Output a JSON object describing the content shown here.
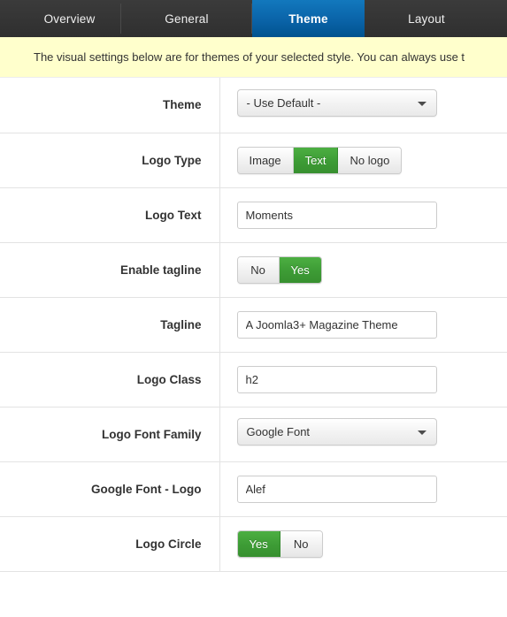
{
  "tabs": [
    {
      "label": "Overview",
      "active": false,
      "name": "tab-overview"
    },
    {
      "label": "General",
      "active": false,
      "name": "tab-general"
    },
    {
      "label": "Theme",
      "active": true,
      "name": "tab-theme"
    },
    {
      "label": "Layout",
      "active": false,
      "name": "tab-layout"
    }
  ],
  "notice": {
    "text": "The visual settings below are for themes of your selected style. You can always use t"
  },
  "colors": {
    "active_tab": "#0a63a8",
    "tabbar_bg": "#333333",
    "notice_bg": "#ffffcc",
    "toggle_on": "#3d9b35",
    "border": "#cccccc",
    "row_border": "#e3e3e3"
  },
  "rows": [
    {
      "label": "Theme",
      "type": "select",
      "value": "- Use Default -",
      "name": "theme"
    },
    {
      "label": "Logo Type",
      "type": "buttons",
      "options": [
        "Image",
        "Text",
        "No logo"
      ],
      "selected": "Text",
      "name": "logo-type"
    },
    {
      "label": "Logo Text",
      "type": "text",
      "value": "Moments",
      "placeholder": "",
      "name": "logo-text"
    },
    {
      "label": "Enable tagline",
      "type": "buttons",
      "options": [
        "No",
        "Yes"
      ],
      "selected": "Yes",
      "name": "enable-tagline"
    },
    {
      "label": "Tagline",
      "type": "text",
      "value": "A Joomla3+ Magazine Theme",
      "placeholder": "",
      "name": "tagline"
    },
    {
      "label": "Logo Class",
      "type": "text",
      "value": "h2",
      "placeholder": "",
      "name": "logo-class"
    },
    {
      "label": "Logo Font Family",
      "type": "select",
      "value": "Google Font",
      "name": "logo-font-family"
    },
    {
      "label": "Google Font - Logo",
      "type": "text",
      "value": "Alef",
      "placeholder": "",
      "name": "google-font-logo"
    },
    {
      "label": "Logo Circle",
      "type": "buttons",
      "options": [
        "Yes",
        "No"
      ],
      "selected": "Yes",
      "name": "logo-circle"
    }
  ]
}
